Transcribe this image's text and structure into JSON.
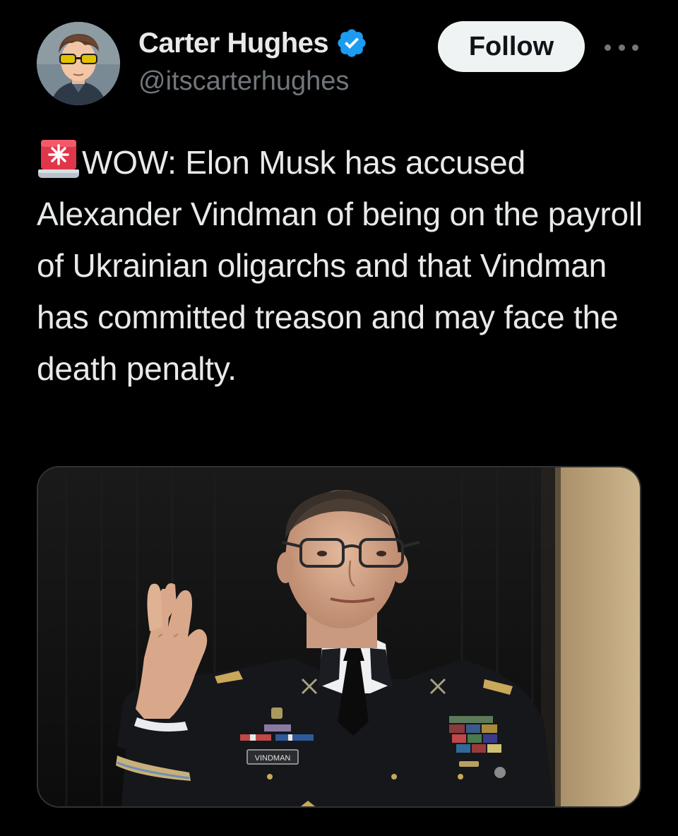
{
  "author": {
    "display_name": "Carter Hughes",
    "handle": "@itscarterhughes",
    "verified": true,
    "avatar_icon": "cartoon-avatar-sunglasses"
  },
  "actions": {
    "follow_label": "Follow",
    "more_icon": "more-horizontal-icon"
  },
  "tweet": {
    "emoji_icon": "police-car-light-emoji",
    "text": "WOW: Elon Musk has accused Alexander Vindman of being on the payroll of Ukrainian oligarchs and that Vindman has committed treason and may face the death penalty."
  },
  "media": {
    "nameplate_text": "VINDMAN"
  },
  "colors": {
    "background": "#000000",
    "text_primary": "#e7e9ea",
    "text_secondary": "#71767b",
    "verified_blue": "#1d9bf0",
    "follow_bg": "#eff3f4"
  }
}
